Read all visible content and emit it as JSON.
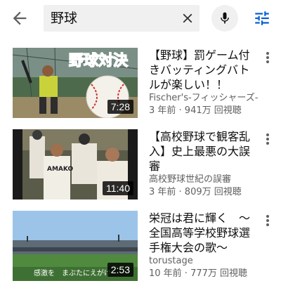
{
  "search": {
    "query": "野球",
    "back_icon": "arrow-back-icon",
    "clear_icon": "close-icon",
    "mic_icon": "mic-icon",
    "filter_icon": "filter-icon"
  },
  "results": [
    {
      "title": "【野球】罰ゲーム付きバッティングバトルが楽しい！！",
      "channel": "Fischer's-フィッシャーズ-",
      "meta": "3 年前 · 941万 回視聴",
      "duration": "7:28",
      "thumb_text": "野球対決"
    },
    {
      "title": "【高校野球で観客乱入】史上最悪の大誤審",
      "channel": "高校野球世紀の誤審",
      "meta": "3 年前 · 809万 回視聴",
      "duration": "11:40",
      "thumb_text": "AMAKO"
    },
    {
      "title": "栄冠は君に輝く　〜全国高等学校野球選手権大会の歌〜",
      "channel": "torustage",
      "meta": "10 年前 · 777万 回視聴",
      "duration": "2:53",
      "thumb_text": "感激を　まぶたにえがけ"
    }
  ]
}
